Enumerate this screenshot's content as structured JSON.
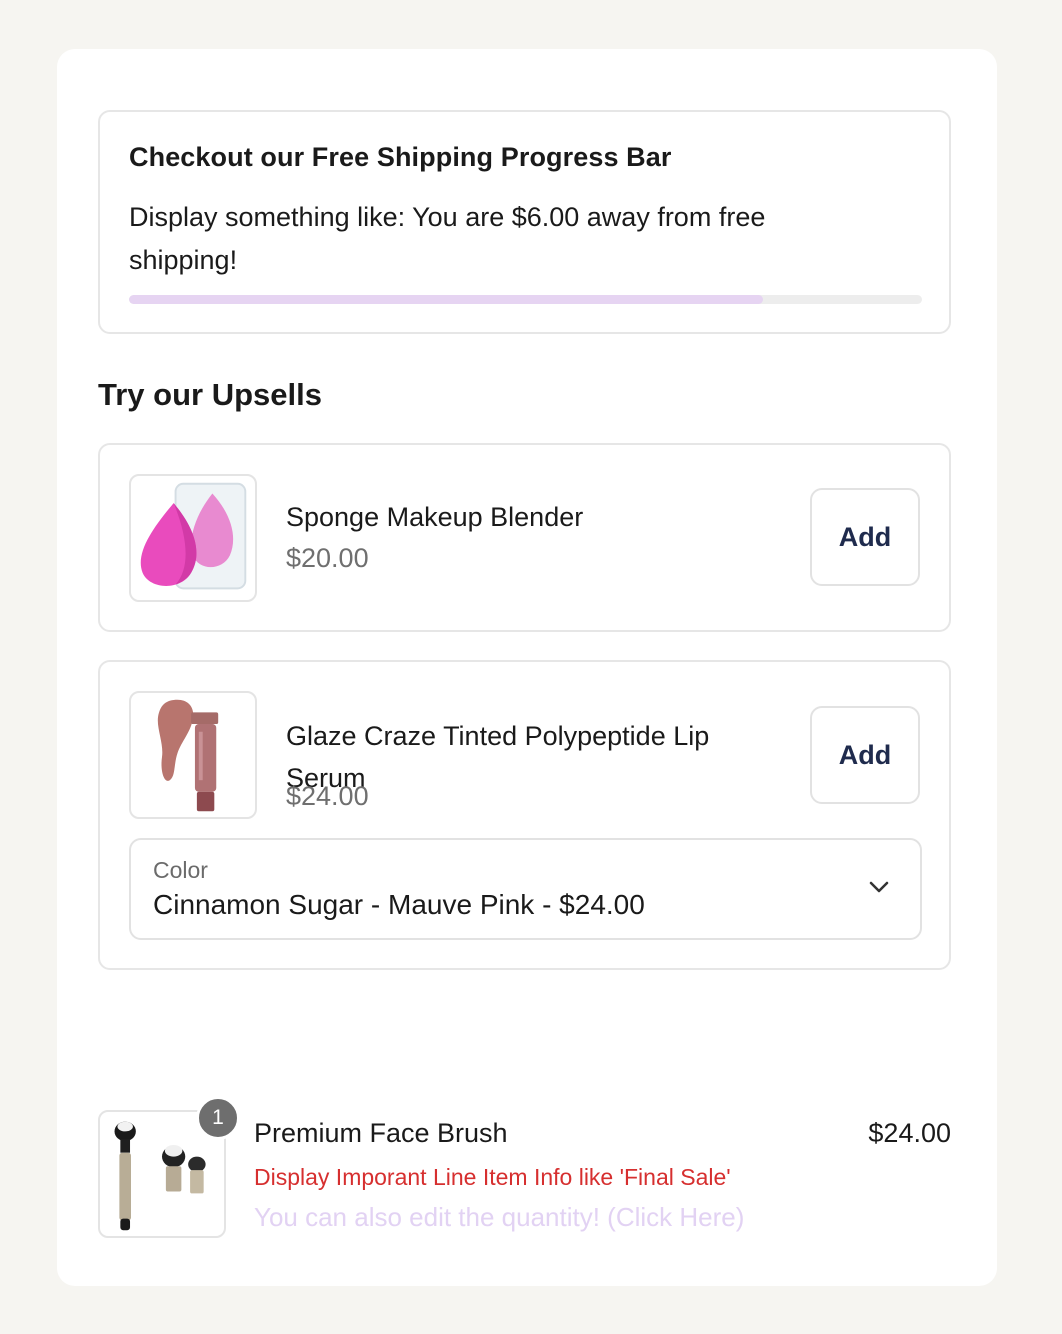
{
  "shipping": {
    "title": "Checkout our Free Shipping Progress Bar",
    "message": "Display something like: You are $6.00 away from free shipping!",
    "progress_fraction": 0.8,
    "bar_color": "#e6d4f2"
  },
  "upsells": {
    "title": "Try our Upsells",
    "items": [
      {
        "name": "Sponge Makeup Blender",
        "price": "$20.00",
        "add_label": "Add",
        "icon": "sponge-image"
      },
      {
        "name": "Glaze Craze Tinted Polypeptide Lip Serum",
        "price": "$24.00",
        "add_label": "Add",
        "icon": "lip-serum-image",
        "variant": {
          "label": "Color",
          "value": "Cinnamon Sugar - Mauve Pink - $24.00"
        }
      }
    ]
  },
  "line_item": {
    "name": "Premium Face Brush",
    "price": "$24.00",
    "quantity": "1",
    "note": "Display Imporant Line Item Info like 'Final Sale'",
    "edit_text": "You can also edit the quantity! (Click Here)",
    "note_color": "#d62f2f",
    "icon": "face-brush-image"
  }
}
